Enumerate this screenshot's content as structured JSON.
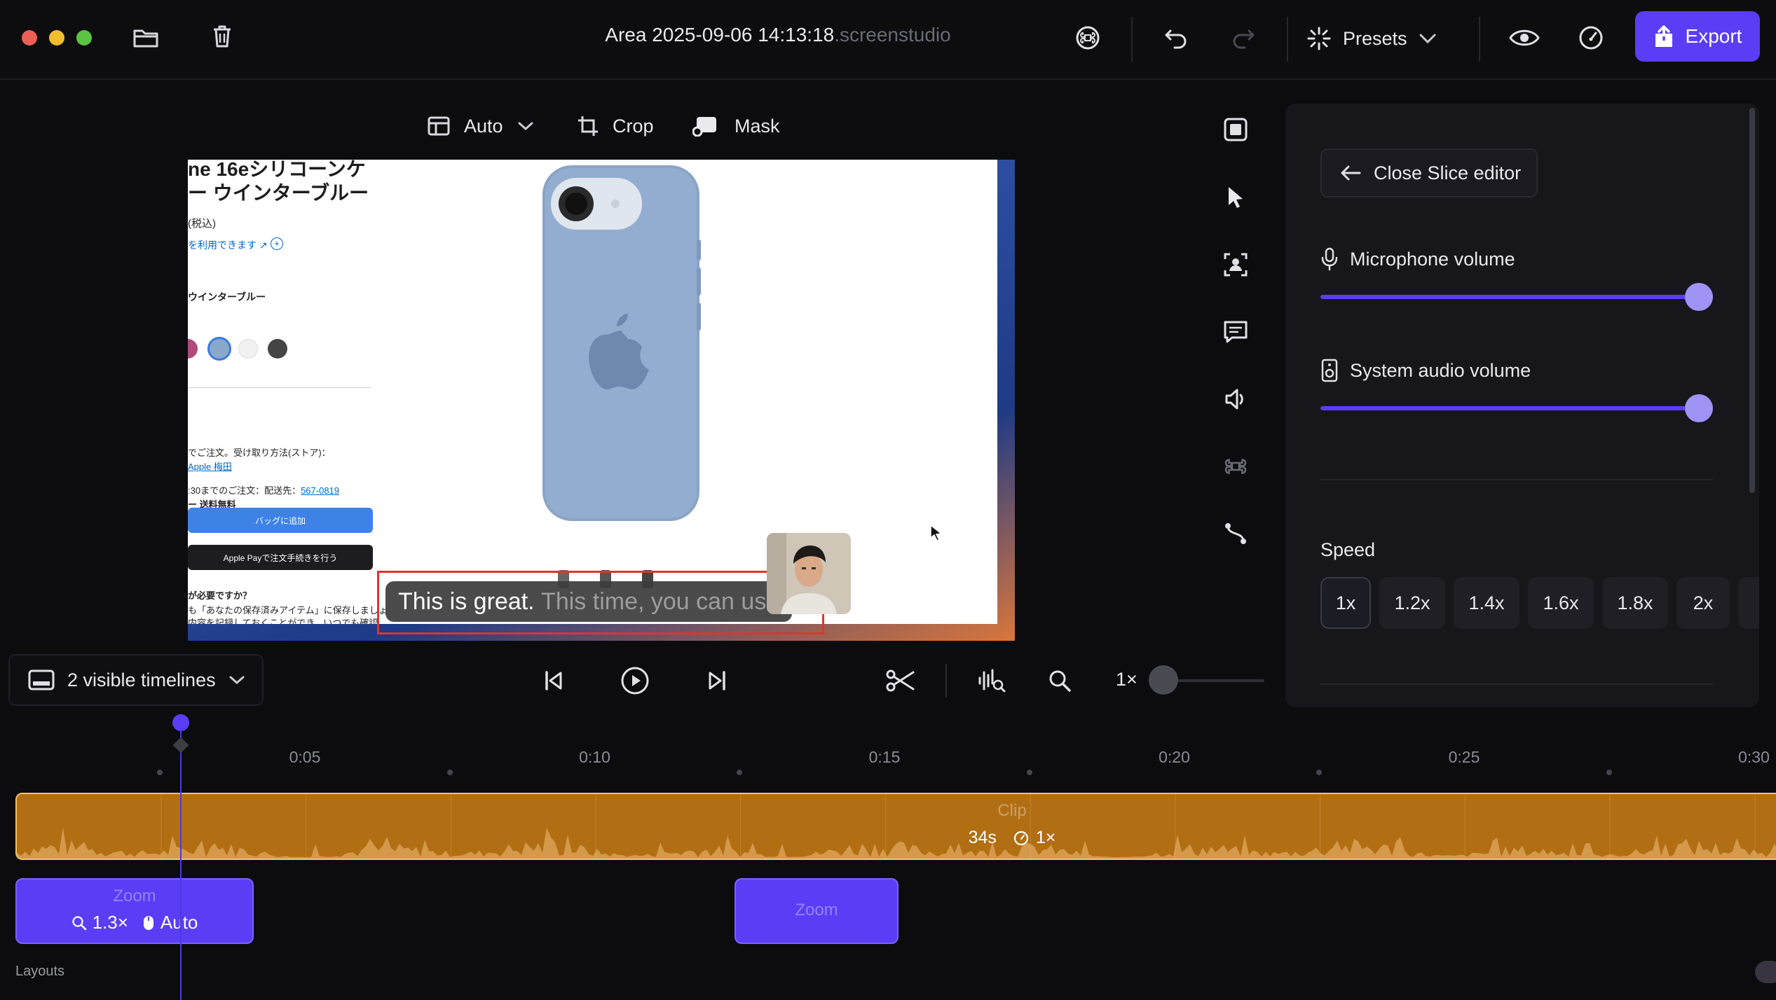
{
  "window": {
    "title": "Area 2025-09-06 14:13:18",
    "title_ext": ".screenstudio"
  },
  "topbar": {
    "presets_label": "Presets",
    "export_label": "Export"
  },
  "editor_toolbar": {
    "aspect_label": "Auto",
    "crop_label": "Crop",
    "mask_label": "Mask"
  },
  "preview": {
    "subtitle_spoken": "This is great.",
    "subtitle_upcoming": "This time, you can use",
    "page_texts": {
      "heading1": "ne 16eシリコーンケ",
      "heading2": "ー ウインターブルー",
      "price_note": "(税込)",
      "apple_pay_note": "を利用できます ↗",
      "color_name": "ウインターブルー",
      "pickup_label": "でご注文。受け取り方法(ストア)：",
      "store_link": "Apple 梅田",
      "delivery_time": ":30までのご注文：配送先：",
      "postal_code": "567-0819",
      "shipping_free": "ー 送料無料",
      "add_to_bag": "バッグに追加",
      "apple_pay_button": "Apple Payで注文手続きを行う",
      "help_heading": "が必要ですか？",
      "help_line1": "も「あなたの保存済みアイテム」に保存しましょ",
      "help_line2": "内容を記録しておくことができ、いつでも確認"
    }
  },
  "side_panel": {
    "close_label": "Close Slice editor",
    "mic_label": "Microphone volume",
    "mic_volume": 1.0,
    "system_label": "System audio volume",
    "system_volume": 1.0,
    "speed_label": "Speed",
    "speed_options": [
      "1x",
      "1.2x",
      "1.4x",
      "1.6x",
      "1.8x",
      "2x"
    ],
    "speed_selected": "1x"
  },
  "playback": {
    "timelines_label": "2 visible timelines",
    "zoom_level_label": "1×",
    "zoom_slider_value": 0
  },
  "timeline": {
    "ticks": [
      "0:05",
      "0:10",
      "0:15",
      "0:20",
      "0:25",
      "0:30"
    ],
    "clip": {
      "label": "Clip",
      "duration": "34s",
      "speed": "1×"
    },
    "zoom_blocks": [
      {
        "label": "Zoom",
        "scale": "1.3×",
        "mode": "Auto"
      },
      {
        "label": "Zoom"
      }
    ],
    "layouts_label": "Layouts"
  },
  "colors": {
    "accent": "#5b3df5",
    "clip": "#b26e12",
    "subtitle_box": "#e0342b"
  }
}
